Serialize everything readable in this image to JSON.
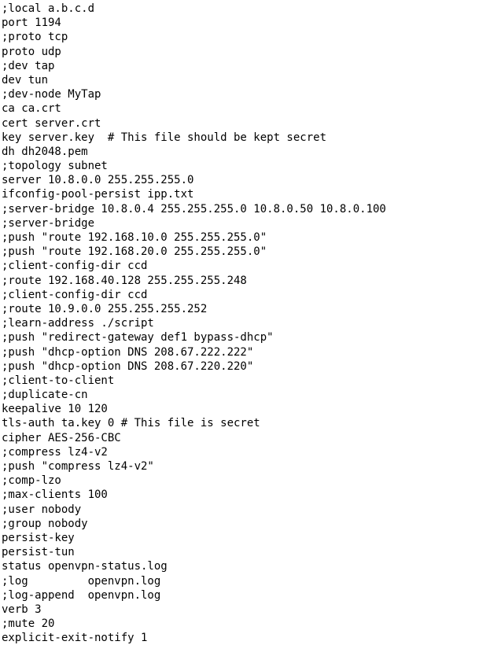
{
  "document": {
    "kind": "plain-text-config",
    "filename": "server.conf",
    "format": "openvpn-server-config",
    "background_color": "#ffffff",
    "text_color": "#000000",
    "comment_prefixes": [
      ";",
      "#"
    ],
    "line_count": 44,
    "lines": [
      ";local a.b.c.d",
      "port 1194",
      ";proto tcp",
      "proto udp",
      ";dev tap",
      "dev tun",
      ";dev-node MyTap",
      "ca ca.crt",
      "cert server.crt",
      "key server.key  # This file should be kept secret",
      "dh dh2048.pem",
      ";topology subnet",
      "server 10.8.0.0 255.255.255.0",
      "ifconfig-pool-persist ipp.txt",
      ";server-bridge 10.8.0.4 255.255.255.0 10.8.0.50 10.8.0.100",
      ";server-bridge",
      ";push \"route 192.168.10.0 255.255.255.0\"",
      ";push \"route 192.168.20.0 255.255.255.0\"",
      ";client-config-dir ccd",
      ";route 192.168.40.128 255.255.255.248",
      ";client-config-dir ccd",
      ";route 10.9.0.0 255.255.255.252",
      ";learn-address ./script",
      ";push \"redirect-gateway def1 bypass-dhcp\"",
      ";push \"dhcp-option DNS 208.67.222.222\"",
      ";push \"dhcp-option DNS 208.67.220.220\"",
      ";client-to-client",
      ";duplicate-cn",
      "keepalive 10 120",
      "tls-auth ta.key 0 # This file is secret",
      "cipher AES-256-CBC",
      ";compress lz4-v2",
      ";push \"compress lz4-v2\"",
      ";comp-lzo",
      ";max-clients 100",
      ";user nobody",
      ";group nobody",
      "persist-key",
      "persist-tun",
      "status openvpn-status.log",
      ";log         openvpn.log",
      ";log-append  openvpn.log",
      "verb 3",
      ";mute 20",
      "explicit-exit-notify 1"
    ]
  }
}
